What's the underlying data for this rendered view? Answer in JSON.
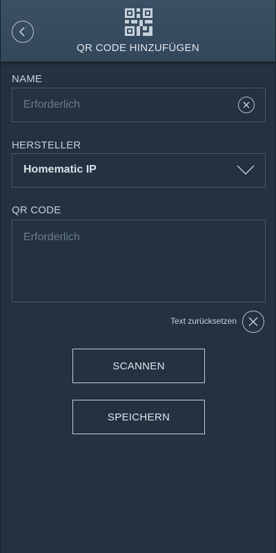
{
  "header": {
    "title": "QR CODE HINZUFÜGEN",
    "back_icon": "chevron-left-icon",
    "qr_icon": "qr-code-icon"
  },
  "form": {
    "name": {
      "label": "NAME",
      "placeholder": "Erforderlich",
      "value": ""
    },
    "manufacturer": {
      "label": "HERSTELLER",
      "value": "Homematic IP"
    },
    "qr_code": {
      "label": "QR CODE",
      "placeholder": "Erforderlich",
      "value": ""
    },
    "reset_label": "Text zurücksetzen"
  },
  "buttons": {
    "scan": "SCANNEN",
    "save": "SPEICHERN"
  },
  "colors": {
    "background": "#233140",
    "header": "#3c5064",
    "text": "#c6d0da",
    "placeholder": "#6d7d8c",
    "border": "#4a5a6a"
  }
}
